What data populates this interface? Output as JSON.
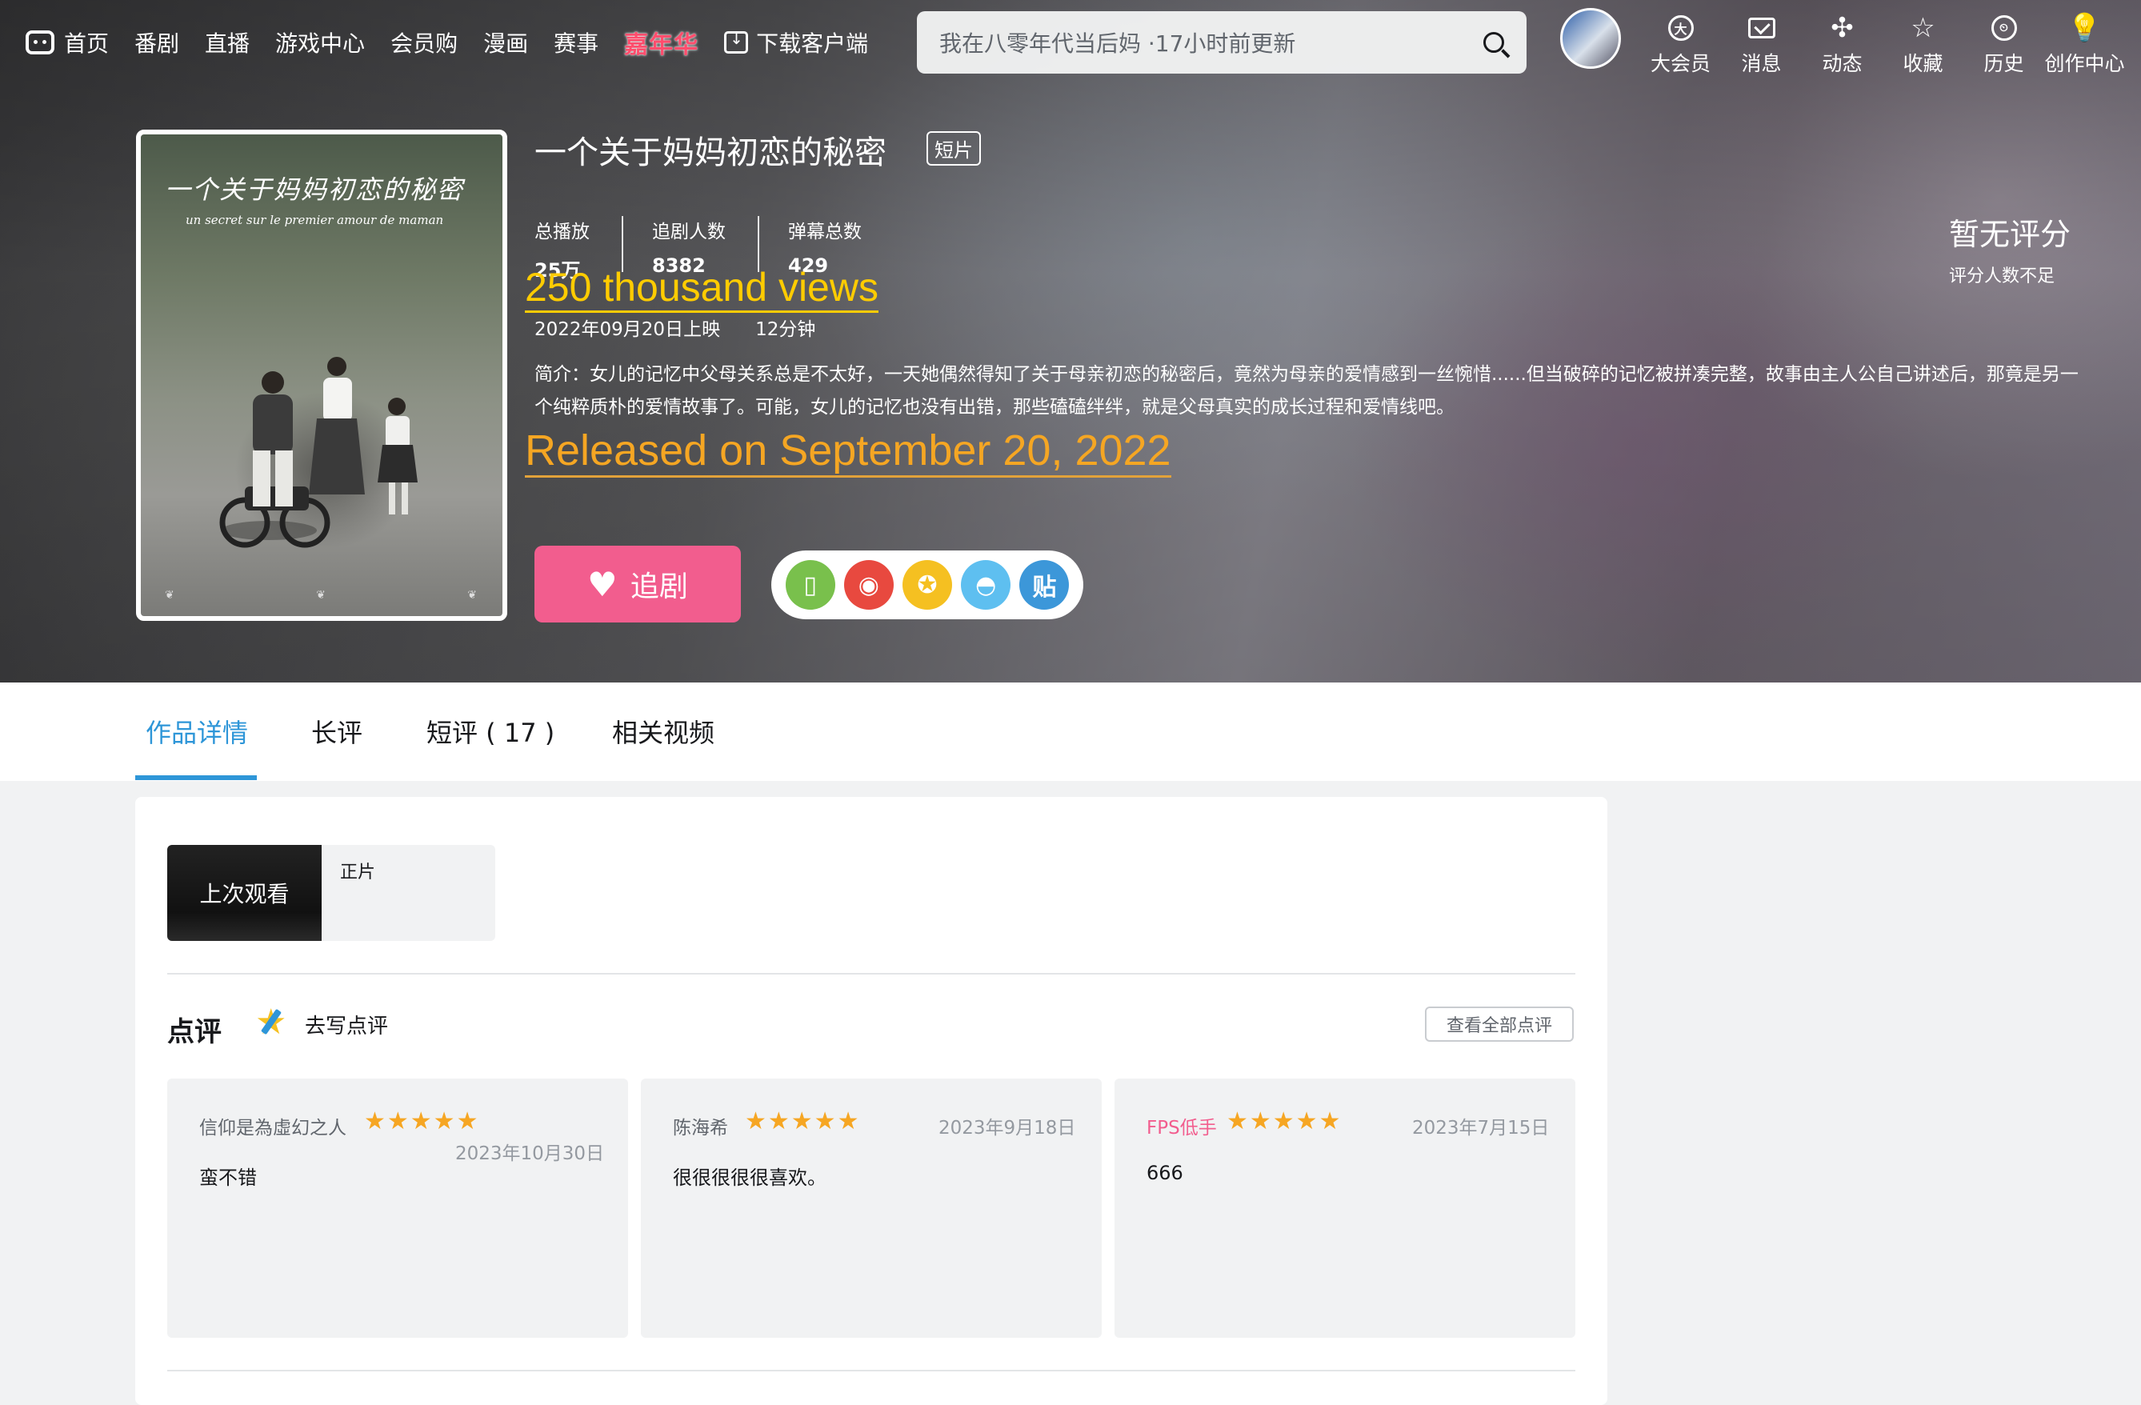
{
  "nav": {
    "items": [
      "首页",
      "番剧",
      "直播",
      "游戏中心",
      "会员购",
      "漫画",
      "赛事"
    ],
    "carnival": "嘉年华",
    "download": "下载客户端"
  },
  "search": {
    "placeholder": "我在八零年代当后妈 ·17小时前更新"
  },
  "user_menu": {
    "items": [
      {
        "label": "大会员",
        "icon": "vip-icon"
      },
      {
        "label": "消息",
        "icon": "message-icon"
      },
      {
        "label": "动态",
        "icon": "dynamic-icon"
      },
      {
        "label": "收藏",
        "icon": "favorite-icon"
      },
      {
        "label": "历史",
        "icon": "history-icon"
      },
      {
        "label": "创作中心",
        "icon": "creator-icon"
      }
    ]
  },
  "poster": {
    "title_cn": "一个关于妈妈初恋的秘密",
    "title_fr": "un secret sur le premier amour de maman"
  },
  "show": {
    "title": "一个关于妈妈初恋的秘密",
    "badge": "短片",
    "stats": [
      {
        "label": "总播放",
        "value": "25万"
      },
      {
        "label": "追剧人数",
        "value": "8382"
      },
      {
        "label": "弹幕总数",
        "value": "429"
      }
    ],
    "release_date": "2022年09月20日上映",
    "duration": "12分钟",
    "description": "简介：女儿的记忆中父母关系总是不太好，一天她偶然得知了关于母亲初恋的秘密后，竟然为母亲的爱情感到一丝惋惜......但当破碎的记忆被拼凑完整，故事由主人公自己讲述后，那竟是另一个纯粹质朴的爱情故事了。可能，女儿的记忆也没有出错，那些磕磕绊绊，就是父母真实的成长过程和爱情线吧。",
    "follow_label": "追剧"
  },
  "annotations": {
    "views": "250 thousand views",
    "released": "Released on September 20, 2022"
  },
  "rating": {
    "main": "暂无评分",
    "sub": "评分人数不足"
  },
  "share": {
    "items": [
      {
        "icon": "phone-icon",
        "color": "#79c04c"
      },
      {
        "icon": "weibo-icon",
        "color": "#e8493f"
      },
      {
        "icon": "qzone-icon",
        "color": "#f5c021"
      },
      {
        "icon": "qq-icon",
        "color": "#5ebff0"
      },
      {
        "icon": "tieba-icon",
        "color": "#3c97d9",
        "label": "贴"
      }
    ]
  },
  "tabs": [
    "作品详情",
    "长评",
    "短评 ( 17 )",
    "相关视频"
  ],
  "episode": {
    "thumb_label": "上次观看",
    "name": "正片"
  },
  "reviews": {
    "title": "点评",
    "write": "去写点评",
    "view_all": "查看全部点评",
    "items": [
      {
        "user": "信仰是為虛幻之人",
        "stars": "★★★★★",
        "date": "2023年10月30日",
        "text": "蛮不错"
      },
      {
        "user": "陈海希",
        "stars": "★★★★★",
        "date": "2023年9月18日",
        "text": "很很很很很喜欢。"
      },
      {
        "user": "FPS低手",
        "stars": "★★★★★",
        "date": "2023年7月15日",
        "text": "666"
      }
    ]
  },
  "colors": {
    "accent": "#2e96d8",
    "pink": "#f25d8e",
    "star": "#f6a623",
    "annotation": "#ffcc00"
  }
}
